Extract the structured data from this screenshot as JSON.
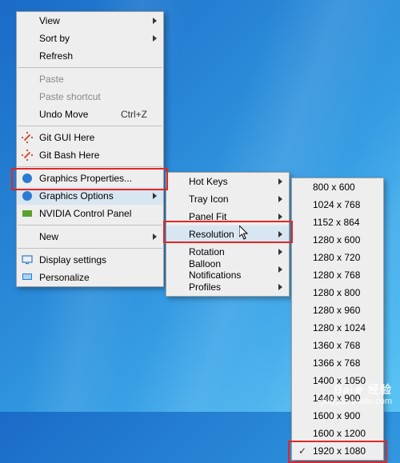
{
  "menu1": {
    "view": "View",
    "sort_by": "Sort by",
    "refresh": "Refresh",
    "paste": "Paste",
    "paste_shortcut": "Paste shortcut",
    "undo_move": "Undo Move",
    "undo_move_shortcut": "Ctrl+Z",
    "git_gui": "Git GUI Here",
    "git_bash": "Git Bash Here",
    "graphics_properties": "Graphics Properties...",
    "graphics_options": "Graphics Options",
    "nvidia_panel": "NVIDIA Control Panel",
    "new": "New",
    "display_settings": "Display settings",
    "personalize": "Personalize"
  },
  "menu2": {
    "hot_keys": "Hot Keys",
    "tray_icon": "Tray Icon",
    "panel_fit": "Panel Fit",
    "resolution": "Resolution",
    "rotation": "Rotation",
    "balloon_notifications": "Balloon Notifications",
    "profiles": "Profiles"
  },
  "resolutions": [
    "800 x 600",
    "1024 x 768",
    "1152 x 864",
    "1280 x 600",
    "1280 x 720",
    "1280 x 768",
    "1280 x 800",
    "1280 x 960",
    "1280 x 1024",
    "1360 x 768",
    "1366 x 768",
    "1400 x 1050",
    "1440 x 900",
    "1600 x 900",
    "1600 x 1200",
    "1920 x 1080"
  ],
  "selected_resolution_index": 15,
  "watermark": {
    "brand": "Bai❀ 经验",
    "url": "jingyan.baidu.com"
  }
}
